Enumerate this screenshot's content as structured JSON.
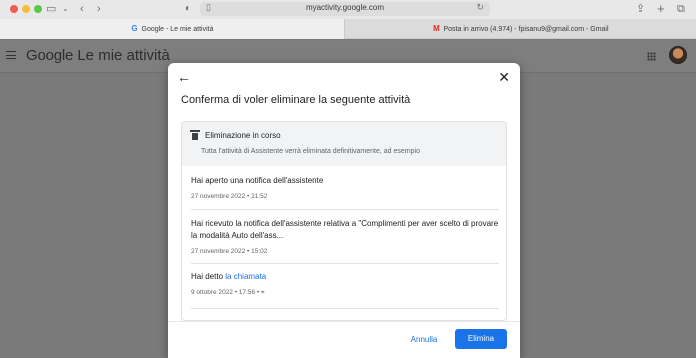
{
  "browser": {
    "url": "myactivity.google.com",
    "tabs": [
      {
        "favicon": "G",
        "label": "Google - Le mie attività"
      },
      {
        "favicon": "M",
        "label": "Posta in arrivo (4.974) - fpisanu9@gmail.com - Gmail"
      }
    ]
  },
  "header": {
    "logo": "Google",
    "title": "Le mie attività"
  },
  "dialog": {
    "title": "Conferma di voler eliminare la seguente attività",
    "card": {
      "heading": "Eliminazione in corso",
      "subtitle": "Tutta l'attività di Assistente verrà eliminata definitivamente, ad esempio"
    },
    "items": [
      {
        "title": "Hai aperto una notifica dell'assistente",
        "meta": "27 novembre 2022 • 21:52"
      },
      {
        "title": "Hai ricevuto la notifica dell'assistente relativa a \"Complimenti per aver scelto di provare la modalità Auto dell'ass...",
        "meta": "27 novembre 2022 • 15:02"
      },
      {
        "title_prefix": "Hai detto",
        "title_link": "la chiamata",
        "meta": "9 ottobre 2022 • 17:56 •"
      }
    ],
    "cancel_label": "Annulla",
    "delete_label": "Elimina"
  },
  "colors": {
    "accent": "#1a73e8",
    "overlay": "#7a7a7a"
  }
}
